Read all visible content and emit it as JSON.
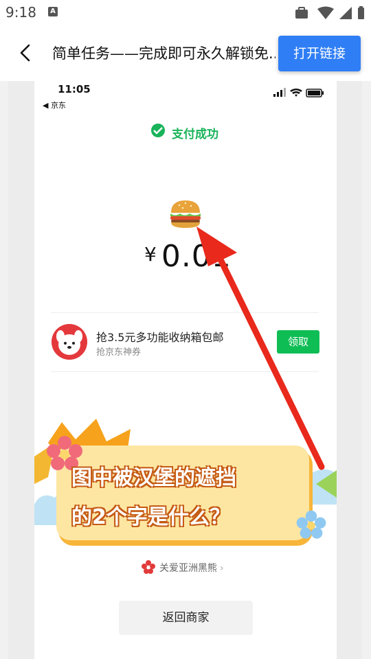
{
  "status_bar": {
    "time": "9:18",
    "notification_icon": "a-icon"
  },
  "header": {
    "title": "简单任务——完成即可永久解锁免..",
    "open_link_label": "打开链接"
  },
  "inner_screen": {
    "time": "11:05",
    "back_label": "◀ 京东",
    "payment_status": "支付成功",
    "amount": "0.01",
    "currency": "¥",
    "coupon": {
      "title": "抢3.5元多功能收纳箱包邮",
      "subtitle": "抢京东神券",
      "claim_label": "领取"
    },
    "banner": {
      "line1": "图中被汉堡的遮挡",
      "line2": "的2个字是什么？"
    },
    "charity_link": "关爱亚洲黑熊",
    "return_label": "返回商家"
  },
  "colors": {
    "accent_blue": "#2f7ef5",
    "success_green": "#19b35a",
    "arrow_red": "#e8291c"
  }
}
